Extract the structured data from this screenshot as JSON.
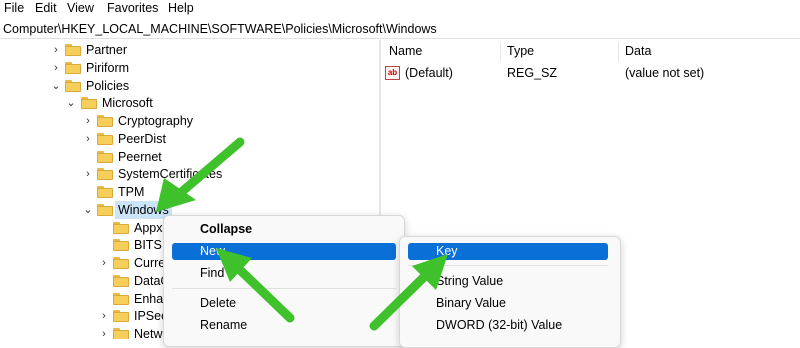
{
  "menu": [
    "File",
    "Edit",
    "View",
    "Favorites",
    "Help"
  ],
  "address": "Computer\\HKEY_LOCAL_MACHINE\\SOFTWARE\\Policies\\Microsoft\\Windows",
  "tree": [
    {
      "label": "Partner",
      "chevron": "›"
    },
    {
      "label": "Piriform",
      "chevron": "›"
    },
    {
      "label": "Policies",
      "chevron": "⌄"
    },
    {
      "label": "Microsoft",
      "chevron": "⌄"
    },
    {
      "label": "Cryptography",
      "chevron": "›"
    },
    {
      "label": "PeerDist",
      "chevron": "›"
    },
    {
      "label": "Peernet",
      "chevron": ""
    },
    {
      "label": "SystemCertificates",
      "chevron": "›"
    },
    {
      "label": "TPM",
      "chevron": ""
    },
    {
      "label": "Windows",
      "chevron": "⌄"
    },
    {
      "label": "Appx",
      "chevron": ""
    },
    {
      "label": "BITS",
      "chevron": ""
    },
    {
      "label": "Curre",
      "chevron": "›"
    },
    {
      "label": "DataC",
      "chevron": ""
    },
    {
      "label": "Enhar",
      "chevron": ""
    },
    {
      "label": "IPSec",
      "chevron": "›"
    },
    {
      "label": "Netw",
      "chevron": "›"
    }
  ],
  "columns": {
    "name": "Name",
    "type": "Type",
    "data": "Data"
  },
  "values": [
    {
      "name": "(Default)",
      "type": "REG_SZ",
      "data": "(value not set)"
    }
  ],
  "context_menu": {
    "collapse": "Collapse",
    "new": "New",
    "find": "Find",
    "delete": "Delete",
    "rename": "Rename"
  },
  "submenu": {
    "key": "Key",
    "string": "String Value",
    "binary": "Binary Value",
    "dword": "DWORD (32-bit) Value"
  },
  "colors": {
    "arrow": "#3ec12a",
    "highlight": "#0a6fd6",
    "selection": "#cce4f7"
  }
}
